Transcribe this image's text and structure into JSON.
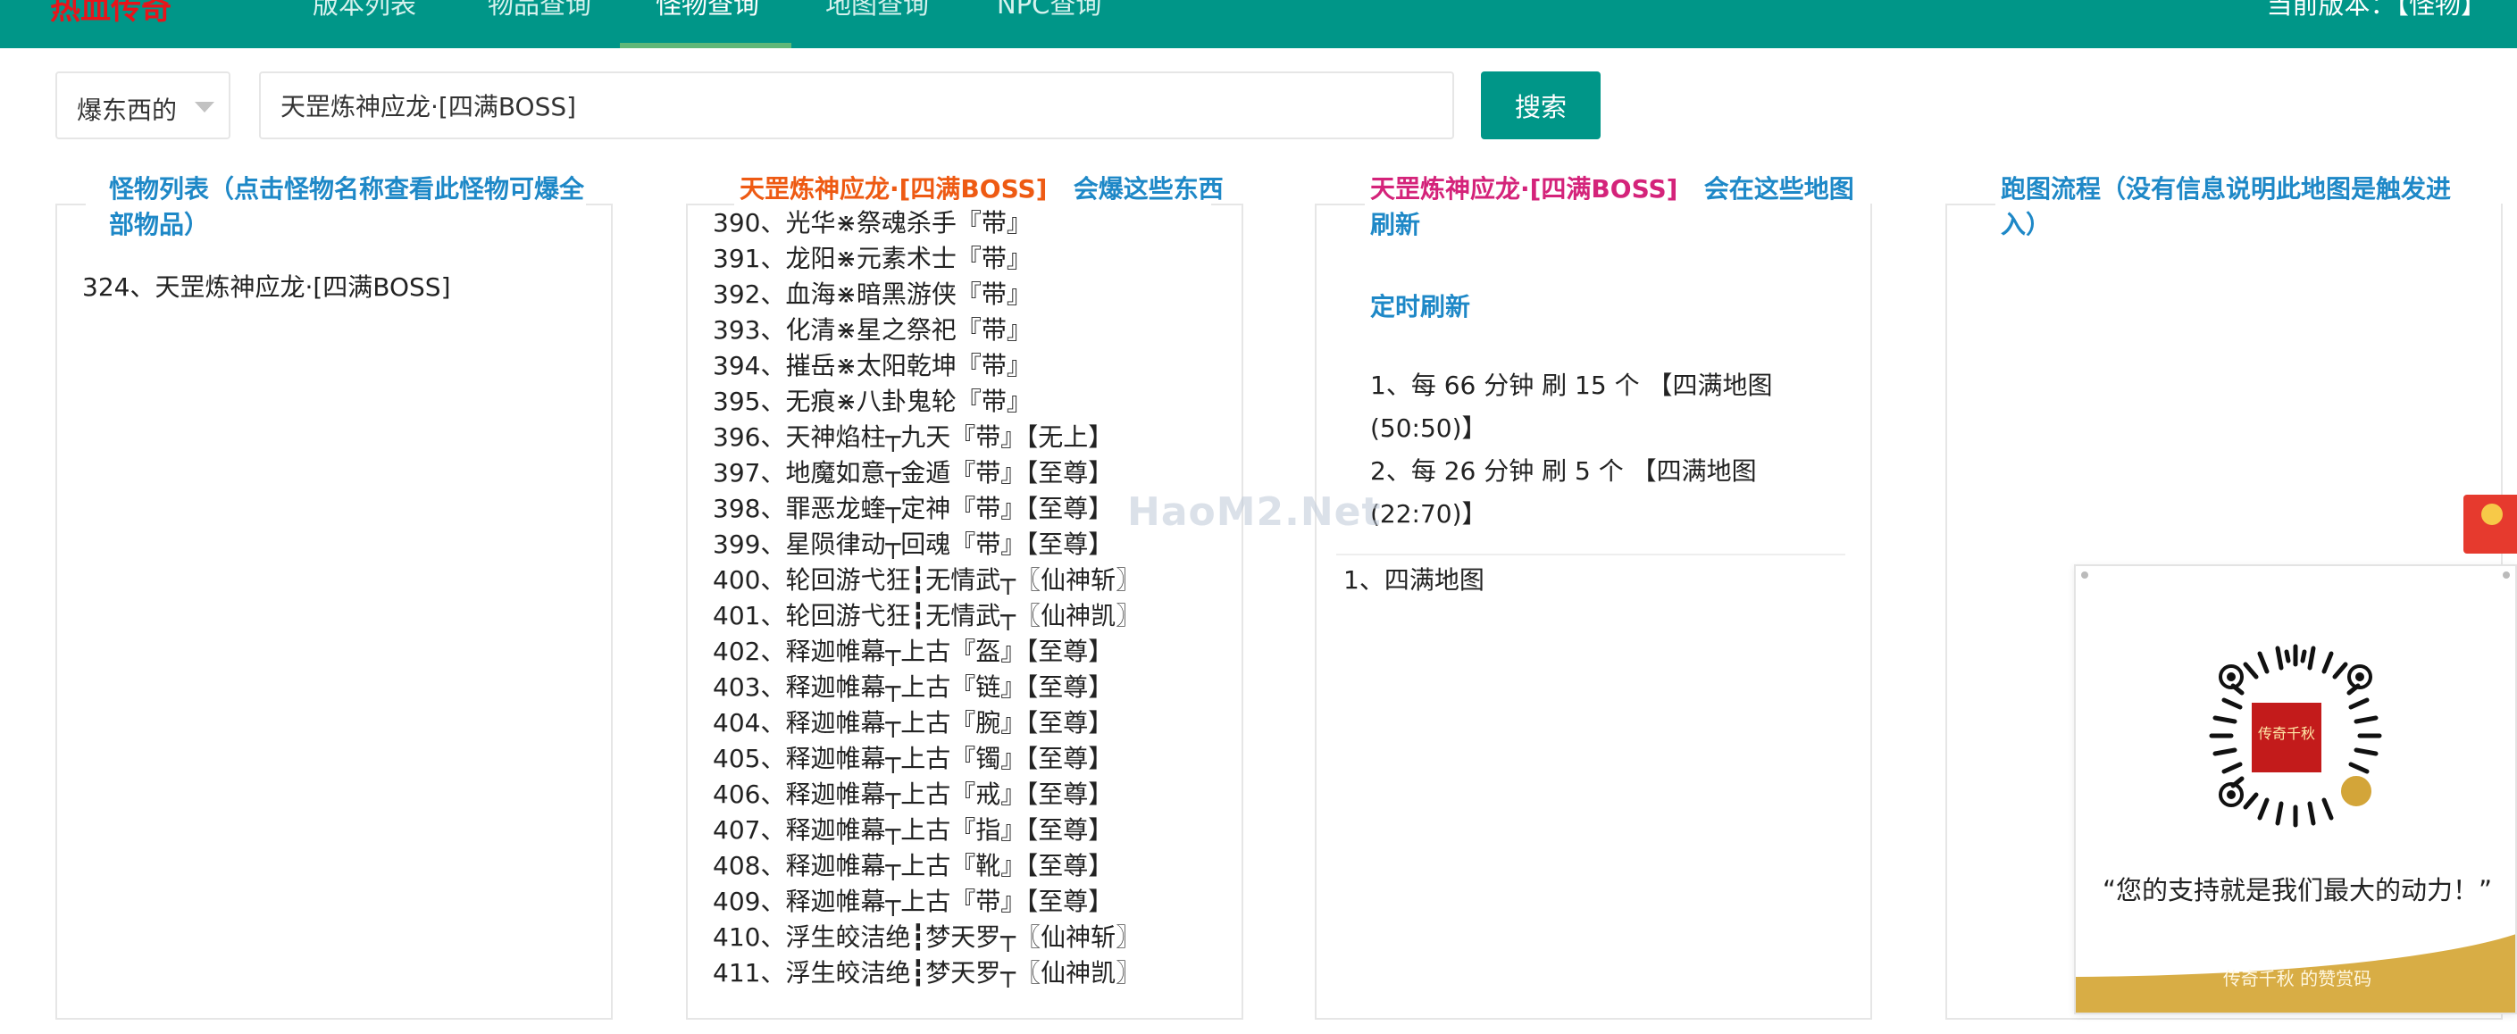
{
  "nav": {
    "brand": "热血传奇",
    "items": [
      "版本列表",
      "物品查询",
      "怪物查询",
      "地图查询",
      "NPC查询"
    ],
    "active_index": 2,
    "version_text": "当前版本：【怪物】"
  },
  "search": {
    "select_value": "爆东西的",
    "input_value": "天罡炼神应龙·[四满BOSS]",
    "button_label": "搜索"
  },
  "panels": {
    "monsters": {
      "title_line1": "怪物列表（点击怪物名称查看此怪物可爆全",
      "title_line2": "部物品）",
      "item": "324、天罡炼神应龙·[四满BOSS]"
    },
    "drops": {
      "title_name": "天罡炼神应龙·[四满BOSS]",
      "title_suffix": "会爆这些东西",
      "items": [
        "390、光华⋇祭魂杀手『带』",
        "391、龙阳⋇元素术士『带』",
        "392、血海⋇暗黑游侠『带』",
        "393、化清⋇星之祭祀『带』",
        "394、摧岳⋇太阳乾坤『带』",
        "395、无痕⋇八卦鬼轮『带』",
        "396、天神焰柱┬九天『带』【无上】",
        "397、地魔如意┬金遁『带』【至尊】",
        "398、罪恶龙蝰┬定神『带』【至尊】",
        "399、星陨律动┬回魂『带』【至尊】",
        "400、轮回游弋狂┇无情武┬〖仙神斩〗",
        "401、轮回游弋狂┇无情武┬〖仙神凯〗",
        "402、释迦帷幕┬上古『盔』【至尊】",
        "403、释迦帷幕┬上古『链』【至尊】",
        "404、释迦帷幕┬上古『腕』【至尊】",
        "405、释迦帷幕┬上古『镯』【至尊】",
        "406、释迦帷幕┬上古『戒』【至尊】",
        "407、释迦帷幕┬上古『指』【至尊】",
        "408、释迦帷幕┬上古『靴』【至尊】",
        "409、释迦帷幕┬上古『带』【至尊】",
        "410、浮生皎洁绝┇梦天罗┬〖仙神斩〗",
        "411、浮生皎洁绝┇梦天罗┬〖仙神凯〗"
      ]
    },
    "maps": {
      "title_name": "天罡炼神应龙·[四满BOSS]",
      "title_suffix": "会在这些地图",
      "title_line2": "刷新",
      "timed_label": "定时刷新",
      "timed_lines": [
        "1、每 66 分钟 刷 15 个 【四满地图",
        "(50:50)】",
        "2、每 26 分钟 刷 5 个 【四满地图",
        "(22:70)】"
      ],
      "map_item": "1、四满地图"
    },
    "route": {
      "title_line1": "跑图流程（没有信息说明此地图是触发进",
      "title_line2": "入）"
    }
  },
  "donate": {
    "qr_center_text": "传奇千秋",
    "quote": "“您的支持就是我们最大的动力！”",
    "footer": "传奇千秋 的赞赏码"
  },
  "watermark": "HaoM2.Net",
  "colors": {
    "nav_bg": "#009688",
    "brand": "#e8141a",
    "title_blue": "#1e88c7",
    "title_red": "#ee5a13",
    "title_pink": "#d4237a",
    "button_bg": "#009688"
  }
}
